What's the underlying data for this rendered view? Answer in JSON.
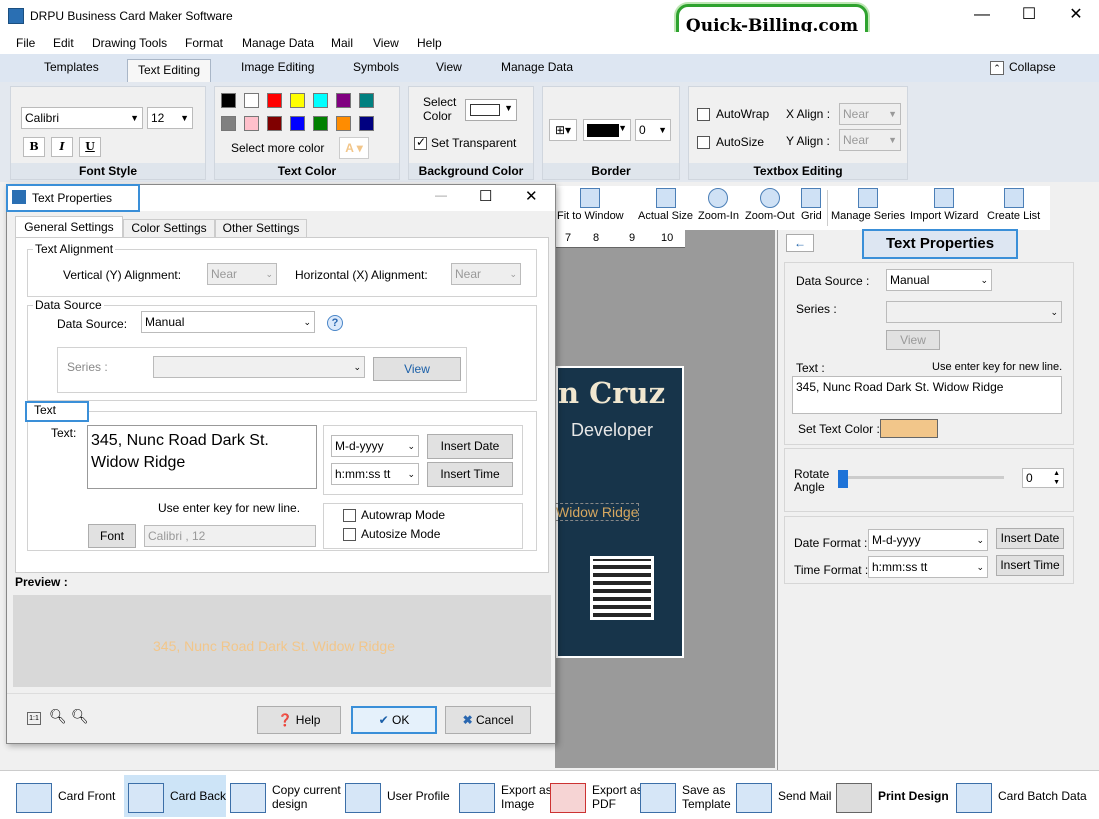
{
  "window": {
    "title": "DRPU Business Card Maker Software",
    "min": "—",
    "max": "☐",
    "close": "✕"
  },
  "brand": "Quick-Billing.com",
  "menu": [
    "File",
    "Edit",
    "Drawing Tools",
    "Format",
    "Manage Data",
    "Mail",
    "View",
    "Help"
  ],
  "ribbon_tabs": {
    "templates": "Templates",
    "text_editing": "Text Editing",
    "image_editing": "Image Editing",
    "symbols": "Symbols",
    "view": "View",
    "manage_data": "Manage Data",
    "collapse": "Collapse"
  },
  "font_style": {
    "font": "Calibri",
    "size": "12",
    "bold": "B",
    "italic": "I",
    "underline": "U",
    "label": "Font Style"
  },
  "text_color": {
    "more": "Select more color",
    "label": "Text Color",
    "swatches": [
      "#000000",
      "#ffffff",
      "#ff0000",
      "#ffff00",
      "#00ffff",
      "#800080",
      "#008080",
      "#808080",
      "#ffc0cb",
      "#800000",
      "#0000ff",
      "#008000",
      "#ff8c00",
      "#000080"
    ]
  },
  "background_color": {
    "select_color": "Select Color",
    "set_transparent": "Set Transparent",
    "label": "Background Color"
  },
  "border": {
    "label": "Border",
    "width": "0"
  },
  "textbox_editing": {
    "autowrap": "AutoWrap",
    "autosize": "AutoSize",
    "x_align": "X Align :",
    "y_align": "Y Align :",
    "x_value": "Near",
    "y_value": "Near",
    "label": "Textbox Editing"
  },
  "toolbar": {
    "fit": "Fit to Window",
    "actual": "Actual Size",
    "zoom_in": "Zoom-In",
    "zoom_out": "Zoom-Out",
    "grid": "Grid",
    "manage_series": "Manage Series",
    "import_wizard": "Import Wizard",
    "create_list": "Create List"
  },
  "card": {
    "name": "n Cruz",
    "role": "Developer",
    "address": "Widow Ridge"
  },
  "ruler": [
    "7",
    "8",
    "9",
    "10"
  ],
  "right_panel": {
    "title": "Text Properties",
    "data_source_label": "Data Source :",
    "data_source": "Manual",
    "series_label": "Series :",
    "view": "View",
    "text_label": "Text :",
    "hint": "Use enter key for new line.",
    "text": "345, Nunc Road Dark St. Widow Ridge",
    "set_text_color": "Set Text Color :",
    "text_color": "#f2c68a",
    "rotate_label": "Rotate Angle",
    "rotate_value": "0",
    "date_format_label": "Date Format :",
    "date_format": "M-d-yyyy",
    "time_format_label": "Time Format :",
    "time_format": "h:mm:ss tt",
    "insert_date": "Insert Date",
    "insert_time": "Insert Time"
  },
  "dialog": {
    "title": "Text Properties",
    "tabs": [
      "General Settings",
      "Color Settings",
      "Other Settings"
    ],
    "text_alignment": "Text Alignment",
    "vertical_label": "Vertical (Y) Alignment:",
    "vertical": "Near",
    "horizontal_label": "Horizontal (X) Alignment:",
    "horizontal": "Near",
    "data_source_group": "Data Source",
    "data_source_label": "Data Source:",
    "data_source": "Manual",
    "series_label": "Series :",
    "view": "View",
    "text_group": "Text",
    "text_label": "Text:",
    "text": "345, Nunc Road Dark St. Widow Ridge",
    "date_format": "M-d-yyyy",
    "time_format": "h:mm:ss tt",
    "insert_date": "Insert Date",
    "insert_time": "Insert Time",
    "hint": "Use enter key for new line.",
    "font_button": "Font",
    "font_value": "Calibri , 12",
    "autowrap": "Autowrap Mode",
    "autosize": "Autosize Mode",
    "preview_label": "Preview :",
    "preview_text": "345, Nunc Road Dark St. Widow Ridge",
    "help": "Help",
    "ok": "OK",
    "cancel": "Cancel"
  },
  "bottom": {
    "card_front": "Card Front",
    "card_back": "Card Back",
    "copy1": "Copy current",
    "copy2": "design",
    "user_profile": "User Profile",
    "export_img1": "Export as",
    "export_img2": "Image",
    "export_pdf1": "Export as",
    "export_pdf2": "PDF",
    "save1": "Save as",
    "save2": "Template",
    "send_mail": "Send Mail",
    "print": "Print Design",
    "batch": "Card Batch Data"
  }
}
